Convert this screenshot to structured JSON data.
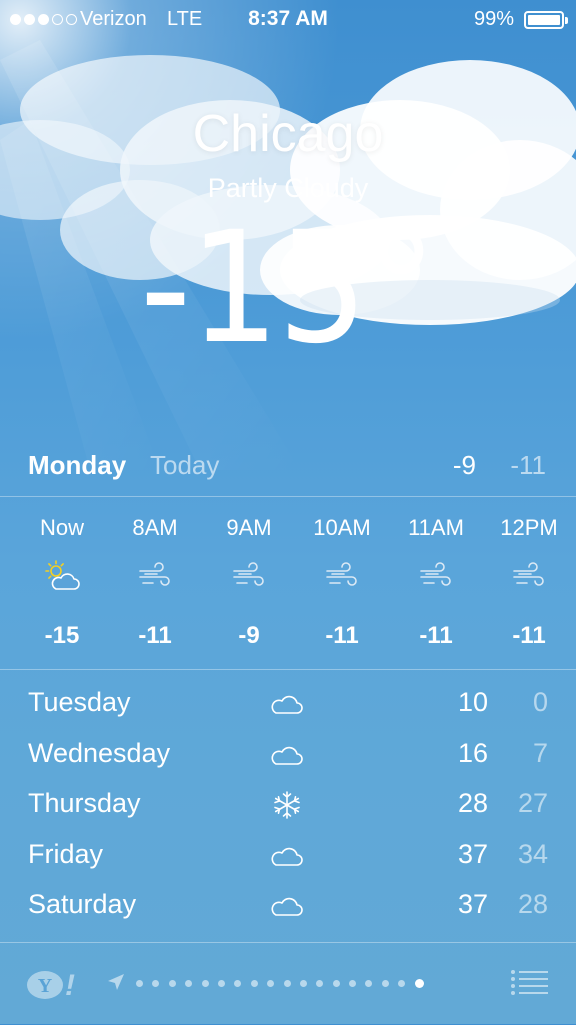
{
  "status_bar": {
    "carrier": "Verizon",
    "network": "LTE",
    "time": "8:37 AM",
    "battery": "99%",
    "signal_bars_filled": 3,
    "signal_bars_total": 5
  },
  "current": {
    "city": "Chicago",
    "condition": "Partly Cloudy",
    "temperature": "-15°"
  },
  "today": {
    "day": "Monday",
    "label": "Today",
    "high": "-9",
    "low": "-11"
  },
  "hourly": [
    {
      "time": "Now",
      "icon": "partly-sunny-icon",
      "temp": "-15"
    },
    {
      "time": "8AM",
      "icon": "wind-icon",
      "temp": "-11"
    },
    {
      "time": "9AM",
      "icon": "wind-icon",
      "temp": "-9"
    },
    {
      "time": "10AM",
      "icon": "wind-icon",
      "temp": "-11"
    },
    {
      "time": "11AM",
      "icon": "wind-icon",
      "temp": "-11"
    },
    {
      "time": "12PM",
      "icon": "wind-icon",
      "temp": "-11"
    }
  ],
  "daily": [
    {
      "day": "Tuesday",
      "icon": "cloud-icon",
      "high": "10",
      "low": "0"
    },
    {
      "day": "Wednesday",
      "icon": "cloud-icon",
      "high": "16",
      "low": "7"
    },
    {
      "day": "Thursday",
      "icon": "snowflake-icon",
      "high": "28",
      "low": "27"
    },
    {
      "day": "Friday",
      "icon": "cloud-icon",
      "high": "37",
      "low": "34"
    },
    {
      "day": "Saturday",
      "icon": "cloud-icon",
      "high": "37",
      "low": "28"
    }
  ],
  "pager": {
    "count": 18,
    "current_index": 17
  },
  "colors": {
    "sky_top": "#3f8fd0",
    "sky_bottom": "#62a9d6",
    "sun": "#f5d020"
  }
}
